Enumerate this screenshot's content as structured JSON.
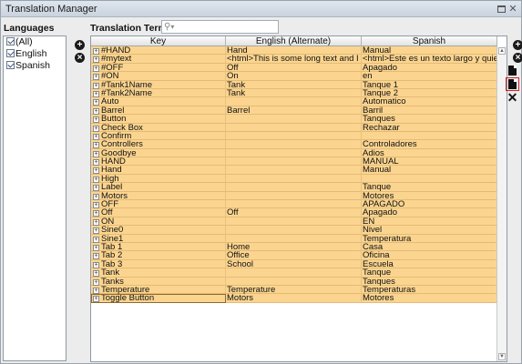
{
  "window": {
    "title": "Translation Manager"
  },
  "languages": {
    "header": "Languages",
    "items": [
      {
        "label": "(All)",
        "checked": true
      },
      {
        "label": "English",
        "checked": true
      },
      {
        "label": "Spanish",
        "checked": true
      }
    ]
  },
  "terms": {
    "header": "Translation Terms",
    "search_placeholder": "",
    "columns": [
      "Key",
      "English (Alternate)",
      "Spanish"
    ],
    "rows": [
      [
        "#HAND",
        "Hand",
        "Manual"
      ],
      [
        "#mytext",
        "<html>This is some long text and I ...",
        "<html>Este es un texto largo y quier..."
      ],
      [
        "#OFF",
        "Off",
        "Apagado"
      ],
      [
        "#ON",
        "On",
        "en"
      ],
      [
        "#Tank1Name",
        "Tank",
        "Tanque 1"
      ],
      [
        "#Tank2Name",
        "Tank",
        "Tanque 2"
      ],
      [
        "Auto",
        "",
        "Automatico"
      ],
      [
        "Barrel",
        "Barrel",
        "Barril"
      ],
      [
        "Button",
        "",
        "Tanques"
      ],
      [
        "Check Box",
        "",
        "Rechazar"
      ],
      [
        "Confirm",
        "",
        ""
      ],
      [
        "Controllers",
        "",
        "Controladores"
      ],
      [
        "Goodbye",
        "",
        "Adios"
      ],
      [
        "HAND",
        "",
        "MANUAL"
      ],
      [
        "Hand",
        "",
        "Manual"
      ],
      [
        "High",
        "",
        ""
      ],
      [
        "Label",
        "",
        "Tanque"
      ],
      [
        "Motors",
        "",
        "Motores"
      ],
      [
        "OFF",
        "",
        "APAGADO"
      ],
      [
        "Off",
        "Off",
        "Apagado"
      ],
      [
        "ON",
        "",
        "EN"
      ],
      [
        "Sine0",
        "",
        "Nivel"
      ],
      [
        "Sine1",
        "",
        "Temperatura"
      ],
      [
        "Tab 1",
        "Home",
        "Casa"
      ],
      [
        "Tab 2",
        "Office",
        "Oficina"
      ],
      [
        "Tab 3",
        "School",
        "Escuela"
      ],
      [
        "Tank",
        "",
        "Tanque"
      ],
      [
        "Tanks",
        "",
        "Tanques"
      ],
      [
        "Temperature",
        "Temperature",
        "Temperaturas"
      ],
      [
        "Toggle Button",
        "Motors",
        "Motores"
      ]
    ]
  },
  "icons": {
    "add_language": "plus-circle-icon",
    "remove_language": "minus-circle-icon",
    "add_term": "plus-circle-icon",
    "remove_term": "minus-circle-icon",
    "import": "import-icon",
    "export": "export-icon",
    "delete": "close-icon"
  },
  "colors": {
    "row_bg": "#fbd590",
    "accent_highlight": "#d32020"
  }
}
